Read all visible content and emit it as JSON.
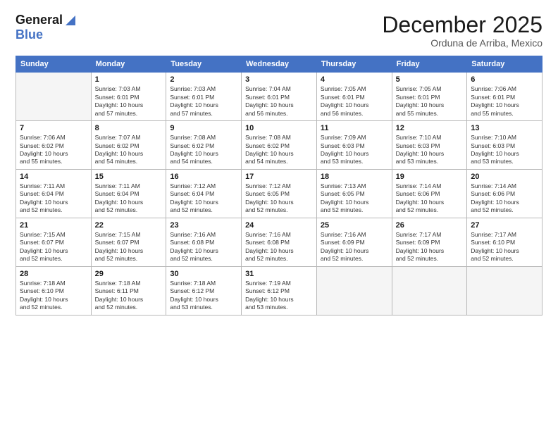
{
  "logo": {
    "line1": "General",
    "line2": "Blue"
  },
  "title": "December 2025",
  "location": "Orduna de Arriba, Mexico",
  "days_header": [
    "Sunday",
    "Monday",
    "Tuesday",
    "Wednesday",
    "Thursday",
    "Friday",
    "Saturday"
  ],
  "weeks": [
    [
      {
        "day": "",
        "detail": ""
      },
      {
        "day": "1",
        "detail": "Sunrise: 7:03 AM\nSunset: 6:01 PM\nDaylight: 10 hours\nand 57 minutes."
      },
      {
        "day": "2",
        "detail": "Sunrise: 7:03 AM\nSunset: 6:01 PM\nDaylight: 10 hours\nand 57 minutes."
      },
      {
        "day": "3",
        "detail": "Sunrise: 7:04 AM\nSunset: 6:01 PM\nDaylight: 10 hours\nand 56 minutes."
      },
      {
        "day": "4",
        "detail": "Sunrise: 7:05 AM\nSunset: 6:01 PM\nDaylight: 10 hours\nand 56 minutes."
      },
      {
        "day": "5",
        "detail": "Sunrise: 7:05 AM\nSunset: 6:01 PM\nDaylight: 10 hours\nand 55 minutes."
      },
      {
        "day": "6",
        "detail": "Sunrise: 7:06 AM\nSunset: 6:01 PM\nDaylight: 10 hours\nand 55 minutes."
      }
    ],
    [
      {
        "day": "7",
        "detail": "Sunrise: 7:06 AM\nSunset: 6:02 PM\nDaylight: 10 hours\nand 55 minutes."
      },
      {
        "day": "8",
        "detail": "Sunrise: 7:07 AM\nSunset: 6:02 PM\nDaylight: 10 hours\nand 54 minutes."
      },
      {
        "day": "9",
        "detail": "Sunrise: 7:08 AM\nSunset: 6:02 PM\nDaylight: 10 hours\nand 54 minutes."
      },
      {
        "day": "10",
        "detail": "Sunrise: 7:08 AM\nSunset: 6:02 PM\nDaylight: 10 hours\nand 54 minutes."
      },
      {
        "day": "11",
        "detail": "Sunrise: 7:09 AM\nSunset: 6:03 PM\nDaylight: 10 hours\nand 53 minutes."
      },
      {
        "day": "12",
        "detail": "Sunrise: 7:10 AM\nSunset: 6:03 PM\nDaylight: 10 hours\nand 53 minutes."
      },
      {
        "day": "13",
        "detail": "Sunrise: 7:10 AM\nSunset: 6:03 PM\nDaylight: 10 hours\nand 53 minutes."
      }
    ],
    [
      {
        "day": "14",
        "detail": "Sunrise: 7:11 AM\nSunset: 6:04 PM\nDaylight: 10 hours\nand 52 minutes."
      },
      {
        "day": "15",
        "detail": "Sunrise: 7:11 AM\nSunset: 6:04 PM\nDaylight: 10 hours\nand 52 minutes."
      },
      {
        "day": "16",
        "detail": "Sunrise: 7:12 AM\nSunset: 6:04 PM\nDaylight: 10 hours\nand 52 minutes."
      },
      {
        "day": "17",
        "detail": "Sunrise: 7:12 AM\nSunset: 6:05 PM\nDaylight: 10 hours\nand 52 minutes."
      },
      {
        "day": "18",
        "detail": "Sunrise: 7:13 AM\nSunset: 6:05 PM\nDaylight: 10 hours\nand 52 minutes."
      },
      {
        "day": "19",
        "detail": "Sunrise: 7:14 AM\nSunset: 6:06 PM\nDaylight: 10 hours\nand 52 minutes."
      },
      {
        "day": "20",
        "detail": "Sunrise: 7:14 AM\nSunset: 6:06 PM\nDaylight: 10 hours\nand 52 minutes."
      }
    ],
    [
      {
        "day": "21",
        "detail": "Sunrise: 7:15 AM\nSunset: 6:07 PM\nDaylight: 10 hours\nand 52 minutes."
      },
      {
        "day": "22",
        "detail": "Sunrise: 7:15 AM\nSunset: 6:07 PM\nDaylight: 10 hours\nand 52 minutes."
      },
      {
        "day": "23",
        "detail": "Sunrise: 7:16 AM\nSunset: 6:08 PM\nDaylight: 10 hours\nand 52 minutes."
      },
      {
        "day": "24",
        "detail": "Sunrise: 7:16 AM\nSunset: 6:08 PM\nDaylight: 10 hours\nand 52 minutes."
      },
      {
        "day": "25",
        "detail": "Sunrise: 7:16 AM\nSunset: 6:09 PM\nDaylight: 10 hours\nand 52 minutes."
      },
      {
        "day": "26",
        "detail": "Sunrise: 7:17 AM\nSunset: 6:09 PM\nDaylight: 10 hours\nand 52 minutes."
      },
      {
        "day": "27",
        "detail": "Sunrise: 7:17 AM\nSunset: 6:10 PM\nDaylight: 10 hours\nand 52 minutes."
      }
    ],
    [
      {
        "day": "28",
        "detail": "Sunrise: 7:18 AM\nSunset: 6:10 PM\nDaylight: 10 hours\nand 52 minutes."
      },
      {
        "day": "29",
        "detail": "Sunrise: 7:18 AM\nSunset: 6:11 PM\nDaylight: 10 hours\nand 52 minutes."
      },
      {
        "day": "30",
        "detail": "Sunrise: 7:18 AM\nSunset: 6:12 PM\nDaylight: 10 hours\nand 53 minutes."
      },
      {
        "day": "31",
        "detail": "Sunrise: 7:19 AM\nSunset: 6:12 PM\nDaylight: 10 hours\nand 53 minutes."
      },
      {
        "day": "",
        "detail": ""
      },
      {
        "day": "",
        "detail": ""
      },
      {
        "day": "",
        "detail": ""
      }
    ]
  ]
}
